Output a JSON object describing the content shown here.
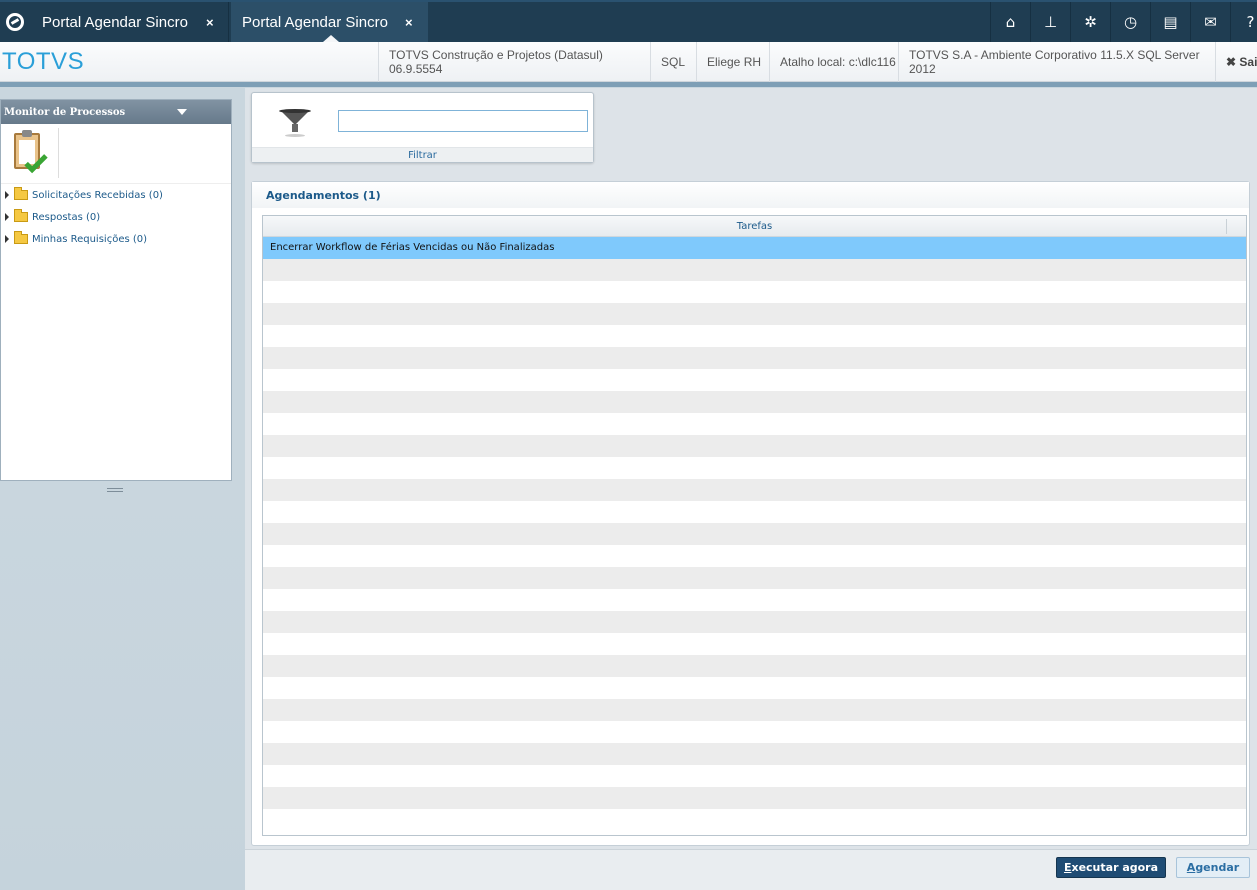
{
  "tabs": [
    {
      "label": "Portal Agendar Sincro",
      "close": "×",
      "active": false
    },
    {
      "label": "Portal Agendar Sincro",
      "close": "×",
      "active": true
    }
  ],
  "top_icons": [
    "home-icon",
    "sitemap-icon",
    "gear-icon",
    "clock-icon",
    "document-icon",
    "mail-icon",
    "help-icon"
  ],
  "top_icon_glyphs": [
    "⌂",
    "⊥",
    "✲",
    "◷",
    "▤",
    "✉",
    "?"
  ],
  "brand": "TOTVS",
  "info": {
    "product": "TOTVS Construção e Projetos (Datasul) 06.9.5554",
    "db": "SQL",
    "user": "Eliege RH",
    "shortcut": "Atalho local: c:\\dlc116",
    "environment": "TOTVS S.A - Ambiente Corporativo 11.5.X SQL Server 2012",
    "logout": "✖ Sair"
  },
  "left_panel": {
    "title": "Monitor de Processos",
    "items": [
      {
        "label": "Solicitações Recebidas (0)"
      },
      {
        "label": "Respostas (0)"
      },
      {
        "label": "Minhas Requisições (0)"
      }
    ]
  },
  "filter": {
    "value": "",
    "label": "Filtrar"
  },
  "schedules": {
    "title": "Agendamentos (1)",
    "column": "Tarefas",
    "rows": [
      "Encerrar Workflow de Férias Vencidas ou Não Finalizadas"
    ]
  },
  "actions": {
    "run_now_first": "E",
    "run_now_rest": "xecutar agora",
    "schedule_first": "A",
    "schedule_rest": "gendar"
  },
  "colors": {
    "accent": "#2a9fd8",
    "header_bg": "#1f3d52",
    "selected_row": "#7fc9fc",
    "primary_button": "#1f4c74"
  }
}
